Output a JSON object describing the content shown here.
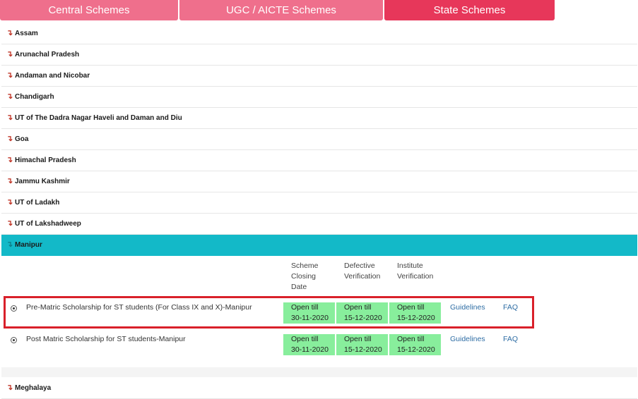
{
  "tabs": [
    {
      "label": "Central Schemes"
    },
    {
      "label": "UGC / AICTE Schemes"
    },
    {
      "label": "State Schemes"
    }
  ],
  "states": [
    {
      "name": "Assam"
    },
    {
      "name": "Arunachal Pradesh"
    },
    {
      "name": "Andaman and Nicobar"
    },
    {
      "name": "Chandigarh"
    },
    {
      "name": "UT of The Dadra Nagar Haveli and Daman and Diu"
    },
    {
      "name": "Goa"
    },
    {
      "name": "Himachal Pradesh"
    },
    {
      "name": "Jammu Kashmir"
    },
    {
      "name": "UT of Ladakh"
    },
    {
      "name": "UT of Lakshadweep"
    },
    {
      "name": "Manipur"
    },
    {
      "name": "Meghalaya"
    }
  ],
  "columns": {
    "closing": [
      "Scheme",
      "Closing",
      "Date"
    ],
    "defective": [
      "Defective",
      "Verification"
    ],
    "institute": [
      "Institute",
      "Verification"
    ]
  },
  "schemes": [
    {
      "name": "Pre-Matric Scholarship for ST students (For Class IX and X)-Manipur",
      "closing": [
        "Open till",
        "30-11-2020"
      ],
      "defective": [
        "Open till",
        "15-12-2020"
      ],
      "institute": [
        "Open till",
        "15-12-2020"
      ],
      "guidelines": "Guidelines",
      "faq": "FAQ"
    },
    {
      "name": "Post Matric Scholarship for ST students-Manipur",
      "closing": [
        "Open till",
        "30-11-2020"
      ],
      "defective": [
        "Open till",
        "15-12-2020"
      ],
      "institute": [
        "Open till",
        "15-12-2020"
      ],
      "guidelines": "Guidelines",
      "faq": "FAQ"
    }
  ],
  "icons": {
    "state_toggle": "arrow-down-icon",
    "scheme_select": "radio-icon"
  },
  "colors": {
    "tab": "#ef6f8c",
    "tab_active": "#e7375a",
    "state_active": "#13b9c8",
    "open_cell": "#88ee9c",
    "highlight": "#d9202a",
    "link": "#2e6da4"
  }
}
